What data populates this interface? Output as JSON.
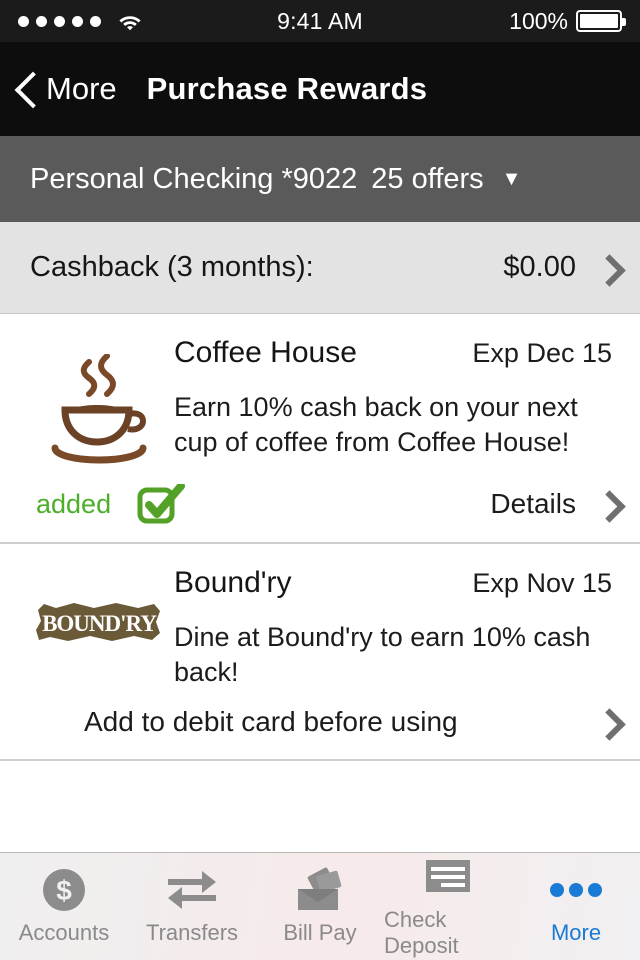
{
  "status_bar": {
    "signal_dots": 5,
    "wifi_icon": "wifi-icon",
    "time": "9:41 AM",
    "battery_percent": "100%",
    "battery_icon": "battery-full-icon"
  },
  "nav": {
    "back_icon": "chevron-left-icon",
    "back_label": "More",
    "title": "Purchase Rewards"
  },
  "account_selector": {
    "account_name": "Personal Checking *9022",
    "offers_count": "25 offers",
    "caret_icon": "chevron-down-icon"
  },
  "cashback": {
    "label": "Cashback (3 months):",
    "amount": "$0.00",
    "chevron_icon": "chevron-right-icon"
  },
  "offers": [
    {
      "logo_icon": "coffee-cup-icon",
      "merchant": "Coffee House",
      "expiry": "Exp Dec 15",
      "description": "Earn 10% cash back on your next cup of coffee from Coffee House!",
      "status_label": "added",
      "status_icon": "checkbox-checked-icon",
      "action_label": "Details",
      "action_icon": "chevron-right-icon"
    },
    {
      "logo_icon": "boundry-logo",
      "logo_text": "BOUND'RY",
      "merchant": "Bound'ry",
      "expiry": "Exp Nov 15",
      "description": "Dine at Bound'ry to earn 10% cash back!",
      "action_label": "Add to debit card before using",
      "action_icon": "chevron-right-icon"
    }
  ],
  "tabs": [
    {
      "label": "Accounts",
      "icon": "dollar-circle-icon",
      "active": false
    },
    {
      "label": "Transfers",
      "icon": "transfer-arrows-icon",
      "active": false
    },
    {
      "label": "Bill Pay",
      "icon": "envelope-icon",
      "active": false
    },
    {
      "label": "Check Deposit",
      "icon": "check-lines-icon",
      "active": false
    },
    {
      "label": "More",
      "icon": "ellipsis-icon",
      "active": true
    }
  ],
  "colors": {
    "status_bar_bg": "#1b1b1b",
    "nav_bg": "#0d0d0d",
    "account_bar_bg": "#5a5a5a",
    "cashback_bg": "#e3e3e3",
    "added_green": "#4caf2a",
    "checkbox_green": "#53a227",
    "active_tab_blue": "#1a7bd4",
    "chevron_gray": "#6f6f6f",
    "coffee_brown": "#7a4a28",
    "boundry_brown": "#6b5a38"
  }
}
